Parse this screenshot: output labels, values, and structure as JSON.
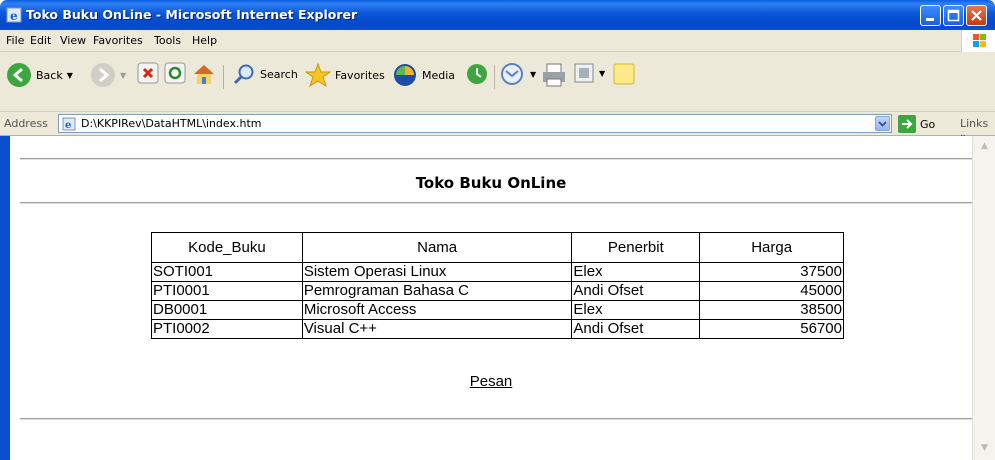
{
  "window": {
    "title": "Toko Buku OnLine - Microsoft Internet Explorer"
  },
  "menu": [
    "File",
    "Edit",
    "View",
    "Favorites",
    "Tools",
    "Help"
  ],
  "toolbar": {
    "back": "Back",
    "search": "Search",
    "favorites": "Favorites",
    "media": "Media"
  },
  "address": {
    "label": "Address",
    "url": "D:\\KKPIRev\\DataHTML\\index.htm",
    "go": "Go",
    "links": "Links"
  },
  "page": {
    "heading": "Toko Buku OnLine",
    "columns": [
      "Kode_Buku",
      "Nama",
      "Penerbit",
      "Harga"
    ],
    "rows": [
      [
        "SOTI001",
        "Sistem Operasi Linux",
        "Elex",
        "37500"
      ],
      [
        "PTI0001",
        "Pemrograman Bahasa C",
        "Andi Ofset",
        "45000"
      ],
      [
        "DB0001",
        "Microsoft Access",
        "Elex",
        "38500"
      ],
      [
        "PTI0002",
        "Visual C++",
        "Andi Ofset",
        "56700"
      ]
    ],
    "order_link": "Pesan"
  }
}
